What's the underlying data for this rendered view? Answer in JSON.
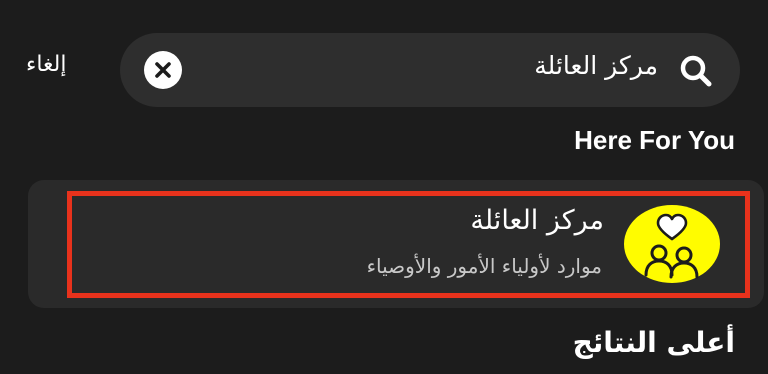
{
  "header": {
    "cancel_label": "إلغاء"
  },
  "search": {
    "value": "مركز العائلة",
    "icon": "search-icon",
    "clear_icon": "close-icon"
  },
  "sections": {
    "here_for_you": "Here For You",
    "top_results": "أعلى النتائج"
  },
  "result": {
    "title": "مركز العائلة",
    "subtitle": "موارد لأولياء الأمور والأوصياء",
    "icon": "family-heart-icon"
  },
  "colors": {
    "background": "#1c1c1c",
    "search_bg": "#2e2e2e",
    "card_bg": "#2a2a2a",
    "highlight": "#e8321c",
    "avatar_yellow": "#fffc00"
  }
}
